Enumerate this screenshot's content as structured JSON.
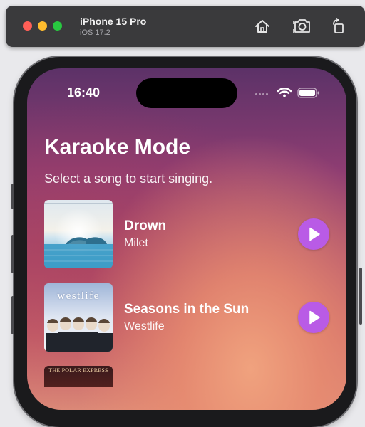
{
  "simulator": {
    "device_name": "iPhone 15 Pro",
    "os_version": "iOS 17.2",
    "toolbar_icons": [
      "home-icon",
      "screenshot-icon",
      "rotate-icon"
    ]
  },
  "status_bar": {
    "time": "16:40",
    "icons": [
      "cellular-icon",
      "wifi-icon",
      "battery-icon"
    ]
  },
  "page": {
    "title": "Karaoke Mode",
    "subtitle": "Select a song to start singing."
  },
  "songs": [
    {
      "title": "Drown",
      "artist": "Milet",
      "cover_icon": "album-cover-drown",
      "action_icon": "play-icon"
    },
    {
      "title": "Seasons in the Sun",
      "artist": "Westlife",
      "cover_text": "westlife",
      "cover_icon": "album-cover-westlife",
      "action_icon": "play-icon"
    },
    {
      "cover_text": "THE POLAR EXPRESS",
      "cover_icon": "album-cover-polar-express"
    }
  ],
  "colors": {
    "play_button": "#b95be6",
    "gradient_top": "#5c3268",
    "gradient_bottom": "#dc8a78"
  }
}
